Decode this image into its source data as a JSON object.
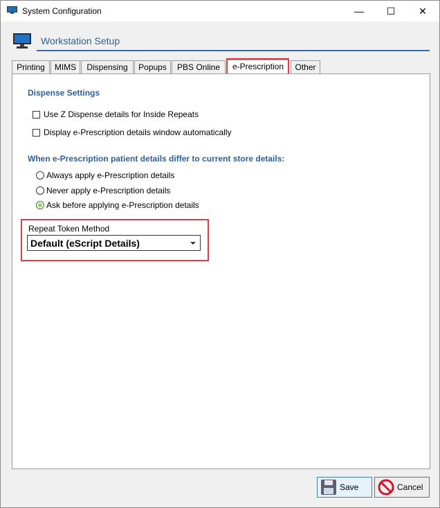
{
  "window": {
    "title": "System Configuration",
    "controls": {
      "minimize": "—",
      "maximize": "☐",
      "close": "✕"
    }
  },
  "header": {
    "title": "Workstation Setup",
    "icon": "monitor-icon"
  },
  "tabs": [
    {
      "label": "Printing",
      "active": false
    },
    {
      "label": "MIMS",
      "active": false
    },
    {
      "label": "Dispensing",
      "active": false
    },
    {
      "label": "Popups",
      "active": false
    },
    {
      "label": "PBS Online",
      "active": false
    },
    {
      "label": "e-Prescription",
      "active": true
    },
    {
      "label": "Other",
      "active": false
    }
  ],
  "dispense_settings": {
    "heading": "Dispense Settings",
    "options": [
      {
        "label": "Use Z Dispense details for Inside Repeats",
        "checked": false
      },
      {
        "label": "Display e-Prescription details window automatically",
        "checked": false
      }
    ]
  },
  "patient_details": {
    "heading": "When e-Prescription patient details differ to current store details:",
    "options": [
      {
        "label": "Always apply e-Prescription details",
        "selected": false
      },
      {
        "label": "Never apply e-Prescription details",
        "selected": false
      },
      {
        "label": "Ask before applying e-Prescription details",
        "selected": true
      }
    ]
  },
  "repeat_token": {
    "label": "Repeat Token Method",
    "selected": "Default (eScript Details)"
  },
  "buttons": {
    "save": "Save",
    "cancel": "Cancel"
  },
  "colors": {
    "accent": "#2f5f97",
    "highlight": "#e03a45"
  }
}
